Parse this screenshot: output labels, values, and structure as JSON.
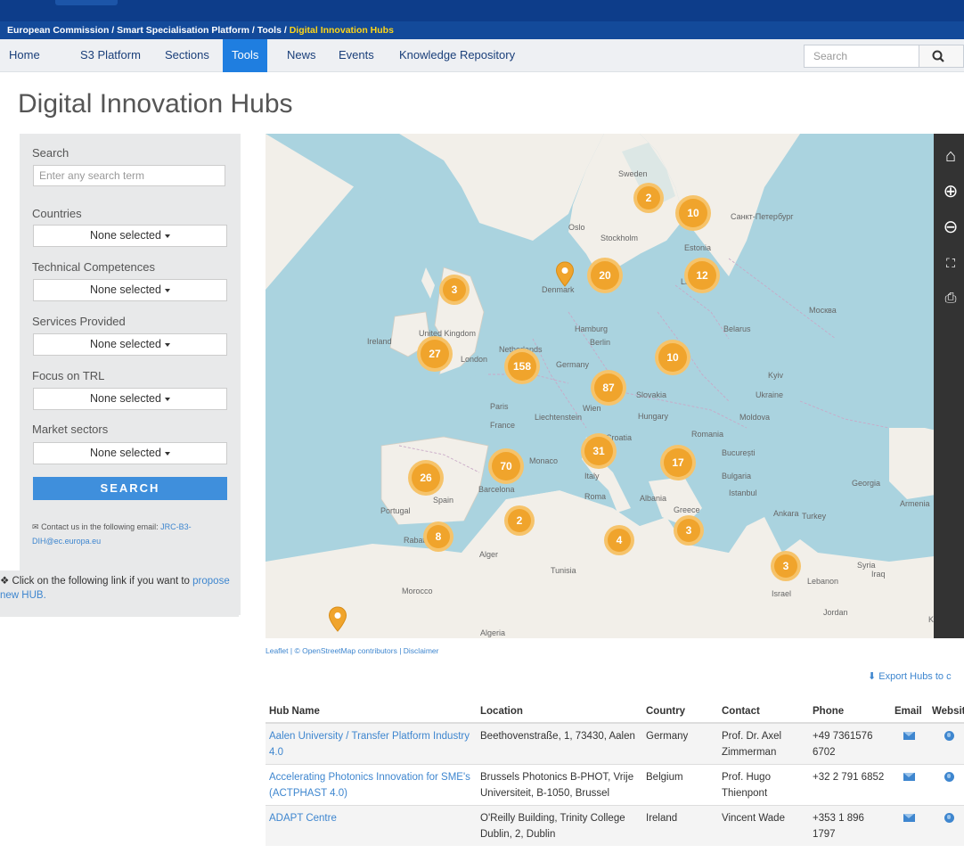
{
  "breadcrumb": {
    "items": [
      "European Commission",
      "Smart Specialisation Platform",
      "Tools"
    ],
    "separator": " / ",
    "current": "Digital Innovation Hubs"
  },
  "nav": {
    "items": [
      "Home",
      "S3 Platform",
      "Sections",
      "Tools",
      "News",
      "Events",
      "Knowledge Repository"
    ],
    "active": "Tools",
    "search_placeholder": "Search"
  },
  "page_title": "Digital Innovation Hubs",
  "sidebar": {
    "search_label": "Search",
    "search_placeholder": "Enter any search term",
    "filters": [
      {
        "label": "Countries",
        "value": "None selected"
      },
      {
        "label": "Technical Competences",
        "value": "None selected"
      },
      {
        "label": "Services Provided",
        "value": "None selected"
      },
      {
        "label": "Focus on TRL",
        "value": "None selected"
      },
      {
        "label": "Market sectors",
        "value": "None selected"
      }
    ],
    "search_button": "SEARCH",
    "contact_text": "Contact us in the following email:",
    "contact_email": "JRC-B3-DIH@ec.europa.eu",
    "propose_text": "Click on the following link if you want to",
    "propose_link": "propose new HUB."
  },
  "map": {
    "clusters": [
      {
        "count": "2"
      },
      {
        "count": "10"
      },
      {
        "count": "20"
      },
      {
        "count": "12"
      },
      {
        "count": "3"
      },
      {
        "count": "27"
      },
      {
        "count": "158"
      },
      {
        "count": "10"
      },
      {
        "count": "87"
      },
      {
        "count": "70"
      },
      {
        "count": "31"
      },
      {
        "count": "17"
      },
      {
        "count": "26"
      },
      {
        "count": "2"
      },
      {
        "count": "8"
      },
      {
        "count": "4"
      },
      {
        "count": "3"
      },
      {
        "count": "3"
      }
    ],
    "labels": [
      "Sweden",
      "Oslo",
      "Stockholm",
      "Санкт-Петербург",
      "Estonia",
      "Denmark",
      "Lithuania",
      "Москва",
      "United Kingdom",
      "Ireland",
      "Hamburg",
      "Netherlands",
      "Berlin",
      "London",
      "Germany",
      "Belarus",
      "Kyiv",
      "Paris",
      "Wien",
      "Slovakia",
      "Ukraine",
      "France",
      "Liechtenstein",
      "Hungary",
      "Moldova",
      "Croatia",
      "Romania",
      "Monaco",
      "București",
      "Italy",
      "Bulgaria",
      "Georgia",
      "Barcelona",
      "Roma",
      "Albania",
      "Istanbul",
      "Spain",
      "Portugal",
      "Greece",
      "Ankara",
      "Turkey",
      "Armenia",
      "Rabat",
      "Alger",
      "Tunisia",
      "Syria",
      "Morocco",
      "Lebanon",
      "Iraq",
      "Israel",
      "Jordan",
      "Algeria",
      "Kuwait"
    ],
    "attribution": "Leaflet | © OpenStreetMap contributors | Disclaimer",
    "colors": {
      "cluster": "#f0a42c",
      "cluster_ring": "#f6c36a",
      "land": "#f2efe9",
      "sea": "#aad3df"
    }
  },
  "export_label": "Export Hubs to c",
  "table": {
    "headers": [
      "Hub Name",
      "Location",
      "Country",
      "Contact",
      "Phone",
      "Email",
      "Websit"
    ],
    "rows": [
      {
        "name": "Aalen University / Transfer Platform Industry 4.0",
        "location": "Beethovenstraße, 1, 73430, Aalen",
        "country": "Germany",
        "contact": "Prof. Dr. Axel Zimmerman",
        "phone": "+49 7361576 6702"
      },
      {
        "name": "Accelerating Photonics Innovation for SME's (ACTPHAST 4.0)",
        "location": "Brussels Photonics B-PHOT, Vrije Universiteit, B-1050, Brussel",
        "country": "Belgium",
        "contact": "Prof. Hugo Thienpont",
        "phone": "+32 2 791 6852"
      },
      {
        "name": "ADAPT Centre",
        "location": "O'Reilly Building, Trinity College Dublin, 2, Dublin",
        "country": "Ireland",
        "contact": "Vincent Wade",
        "phone": "+353 1 896 1797"
      }
    ]
  }
}
